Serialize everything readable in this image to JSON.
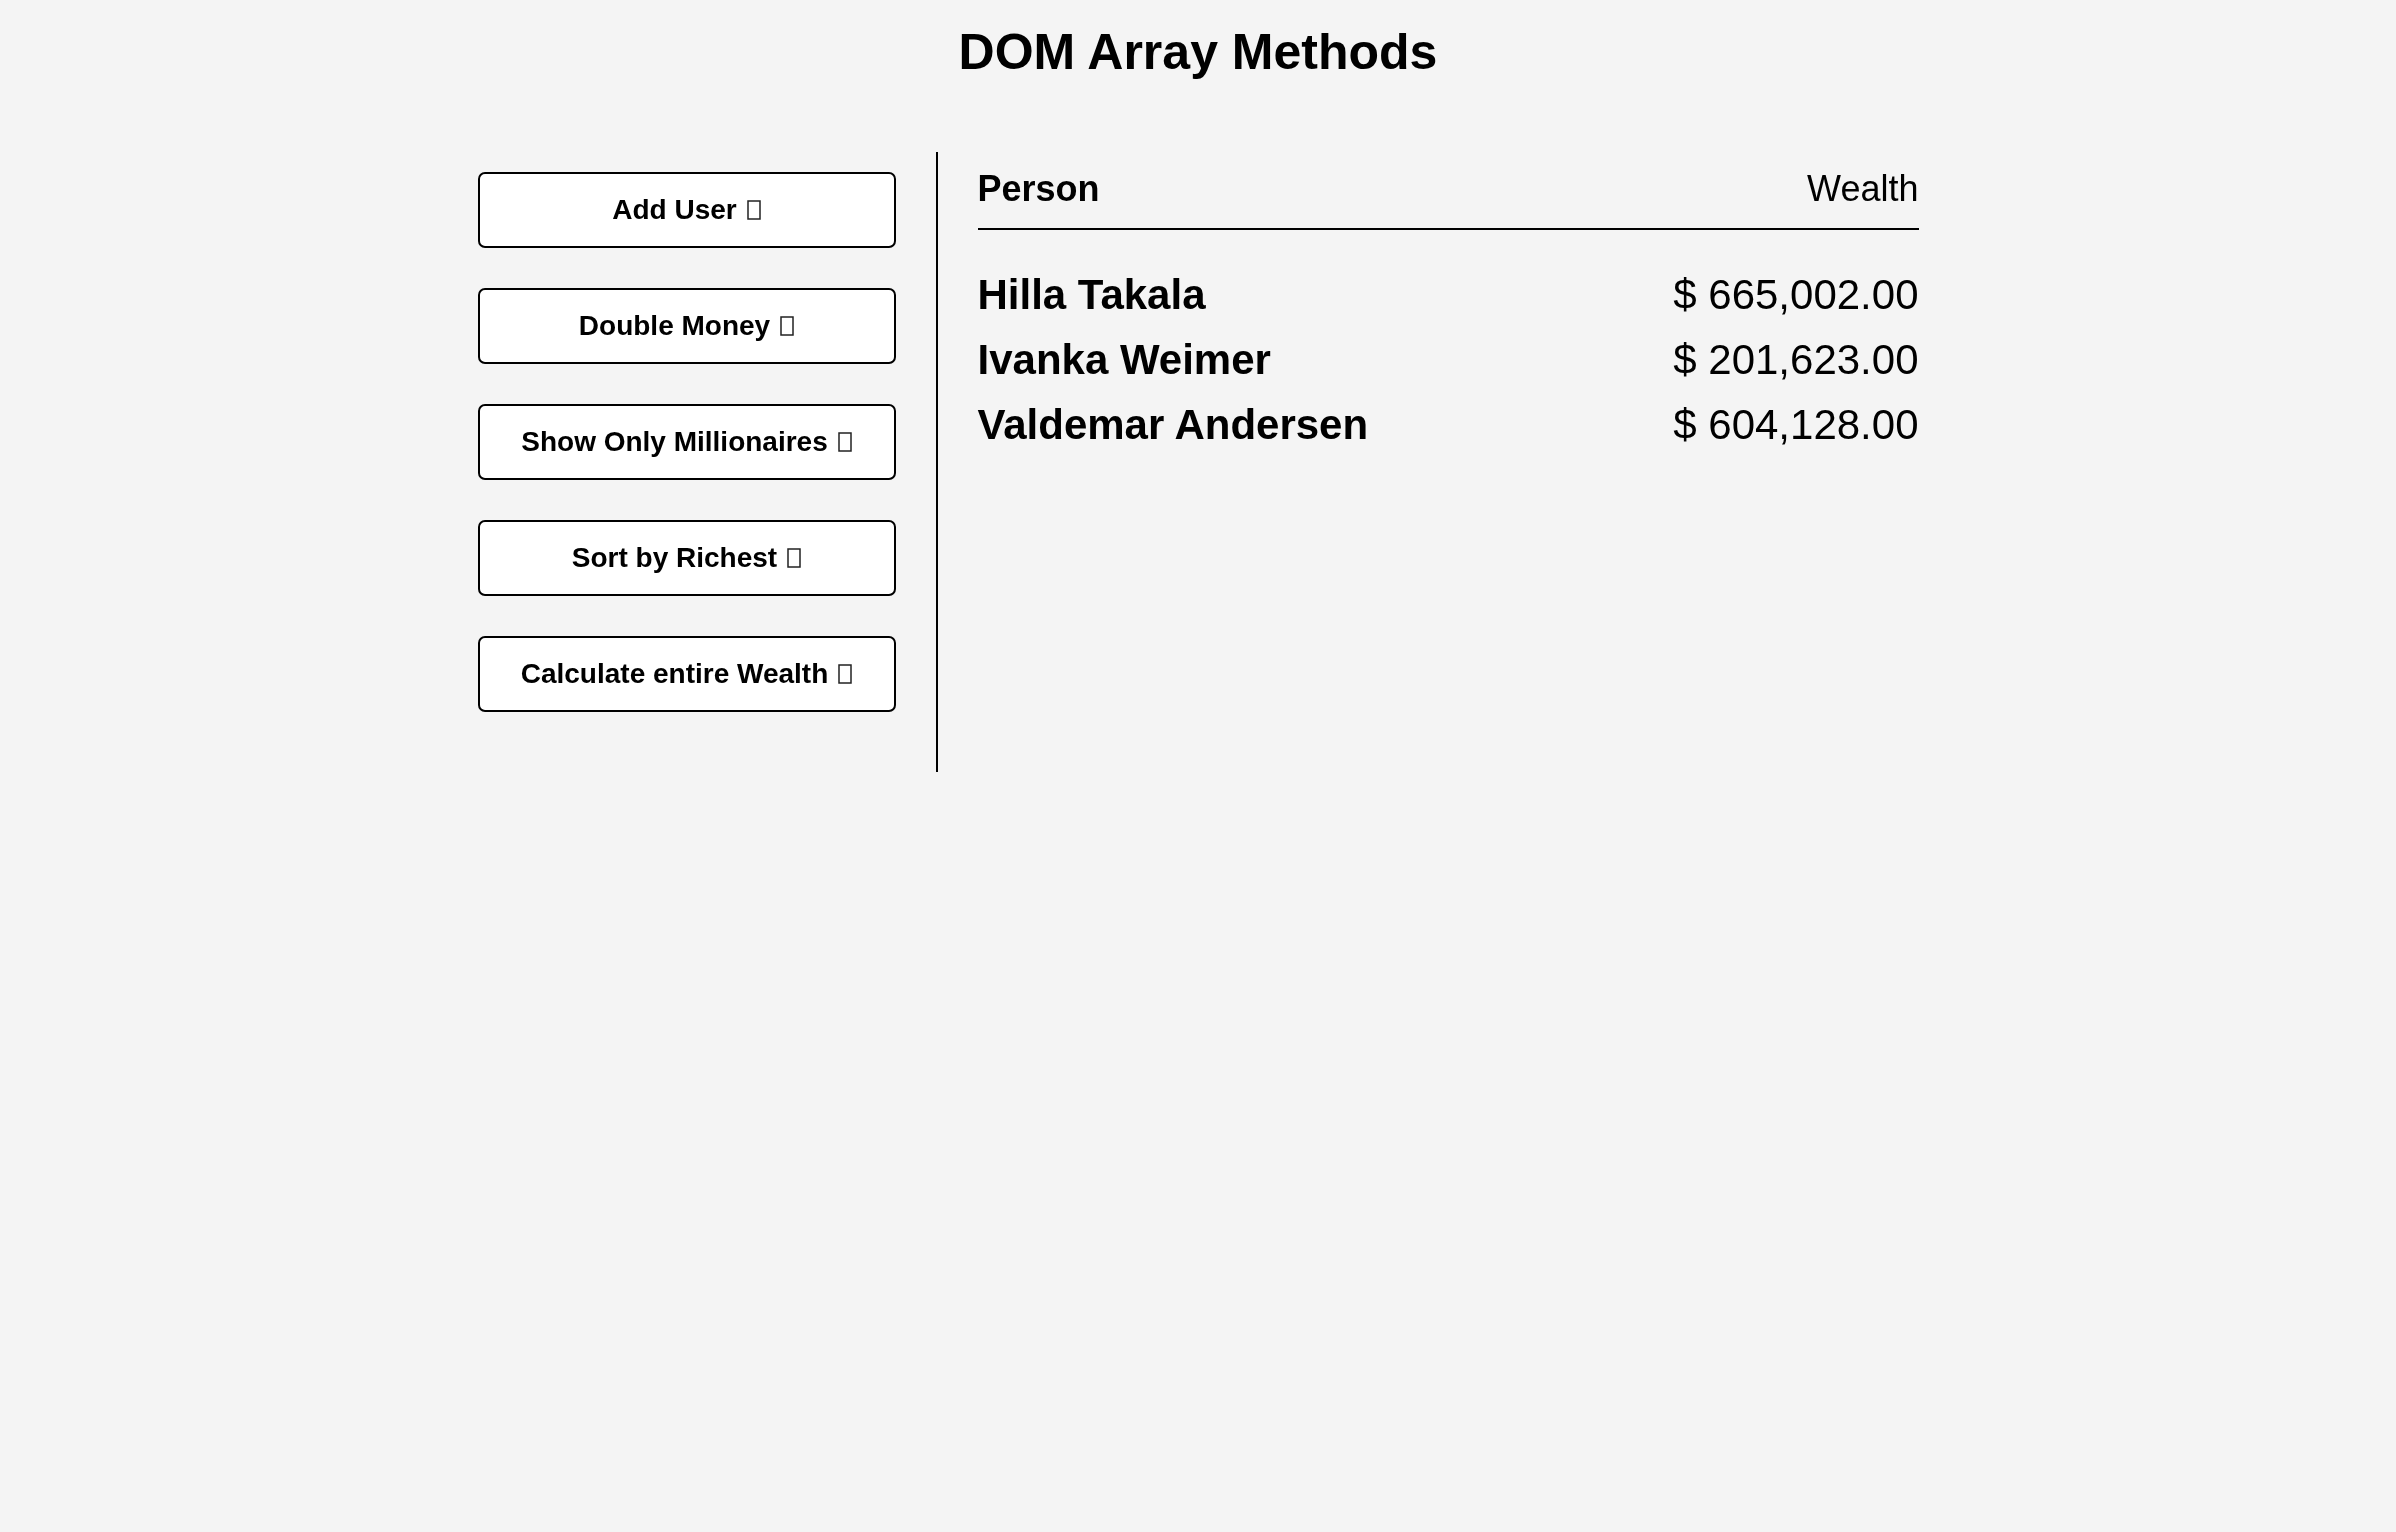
{
  "title": "DOM Array Methods",
  "buttons": [
    "Add User",
    "Double Money",
    "Show Only Millionaires",
    "Sort by Richest",
    "Calculate entire Wealth"
  ],
  "table": {
    "columns": [
      "Person",
      "Wealth"
    ],
    "rows": [
      {
        "person": "Hilla Takala",
        "wealth": "$ 665,002.00"
      },
      {
        "person": "Ivanka Weimer",
        "wealth": "$ 201,623.00"
      },
      {
        "person": "Valdemar Andersen",
        "wealth": "$ 604,128.00"
      }
    ]
  }
}
